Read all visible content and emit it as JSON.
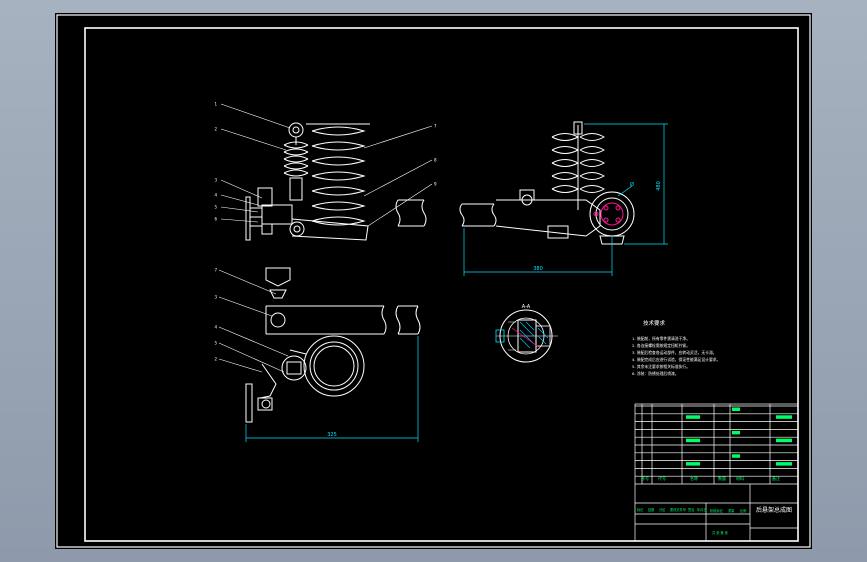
{
  "drawing": {
    "colors": {
      "background": "#000000",
      "frame": "#ffffff",
      "part_outline": "#ffffff",
      "dimension": "#00e5ff",
      "leader": "#ffffff",
      "center_mark": "#ff1493",
      "hatch": "#00c8ff",
      "annotation_text": "#ffffff",
      "title_block_fill": "#00ff66",
      "window_backdrop": "#9aa5b5"
    },
    "title_block": {
      "drawing_name": "后悬架总成图",
      "header_labels": [
        "序号",
        "代号",
        "名称",
        "数量",
        "材料",
        "备注"
      ],
      "sign_labels": [
        "标记",
        "处数",
        "分区",
        "更改文件号",
        "签名",
        "年月日"
      ],
      "stage_labels": [
        "阶段标记",
        "重量",
        "比例"
      ],
      "sheet_label": "共 张 第 张"
    },
    "technical_requirements": {
      "title": "技术要求",
      "items": [
        "1. 装配前，所有零件需清洗干净。",
        "2. 各连接螺栓需按规定扭矩拧紧。",
        "3. 装配后检查各运动部件，应转动灵活，无卡滞。",
        "4. 装配完成后应进行试验，保证性能满足设计要求。",
        "5. 其余未注要求按相关标准执行。",
        "6. 涂装：防锈处理后喷漆。"
      ]
    },
    "section_label": "A-A",
    "dimensions": {
      "overall_length_front": "325",
      "overall_length_plan": "380",
      "height_side": "480",
      "diameter_callout": "Ø"
    },
    "balloons": {
      "front_view_left": [
        "1",
        "2",
        "3",
        "4",
        "5",
        "6"
      ],
      "front_view_right": [
        "7",
        "8",
        "9"
      ],
      "plan_view": [
        "7",
        "3",
        "4",
        "5",
        "2"
      ]
    }
  }
}
